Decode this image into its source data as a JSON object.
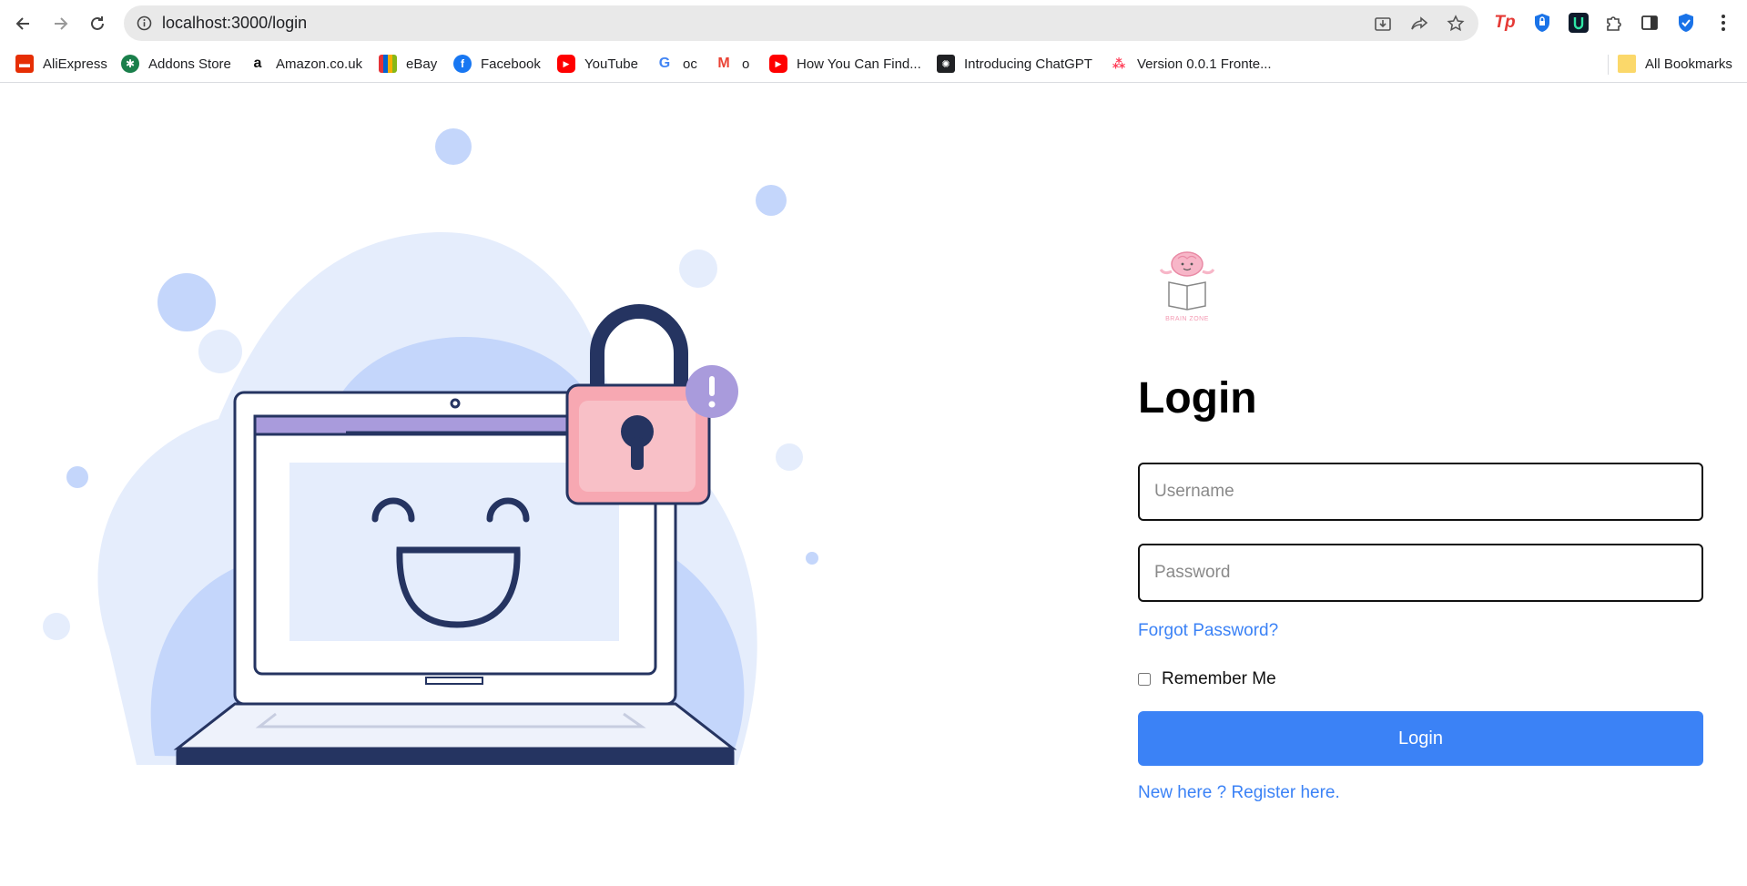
{
  "browser": {
    "url": "localhost:3000/login",
    "bookmarks": [
      {
        "label": "AliExpress",
        "icon": "aliexpress-icon",
        "color": "#e62e04"
      },
      {
        "label": "Addons Store",
        "icon": "addons-store-icon",
        "color": "#1a7f4b"
      },
      {
        "label": "Amazon.co.uk",
        "icon": "amazon-icon",
        "color": "#111111"
      },
      {
        "label": "eBay",
        "icon": "ebay-icon",
        "color": "#e53238"
      },
      {
        "label": "Facebook",
        "icon": "facebook-icon",
        "color": "#1877f2"
      },
      {
        "label": "YouTube",
        "icon": "youtube-icon",
        "color": "#ff0000"
      },
      {
        "label": "oc",
        "icon": "google-icon",
        "color": "#4285f4"
      },
      {
        "label": "o",
        "icon": "gmail-icon",
        "color": "#ea4335"
      },
      {
        "label": "How You Can Find...",
        "icon": "youtube-icon",
        "color": "#ff0000"
      },
      {
        "label": "Introducing ChatGPT",
        "icon": "chatgpt-icon",
        "color": "#202124"
      },
      {
        "label": "Version 0.0.1 Fronte...",
        "icon": "monday-icon",
        "color": "#ff3d57"
      }
    ],
    "all_bookmarks": "All Bookmarks"
  },
  "login": {
    "title": "Login",
    "username_placeholder": "Username",
    "password_placeholder": "Password",
    "forgot": "Forgot Password?",
    "remember": "Remember Me",
    "button": "Login",
    "register": "New here ? Register here."
  },
  "logo": {
    "text": "BRAIN ZONE"
  },
  "colors": {
    "accent": "#3b82f6",
    "illustration_light": "#e5edfc",
    "illustration_mid": "#c4d6fb",
    "navy": "#253461",
    "lock_pink": "#f7a8b2",
    "badge_purple": "#a99bdc"
  }
}
